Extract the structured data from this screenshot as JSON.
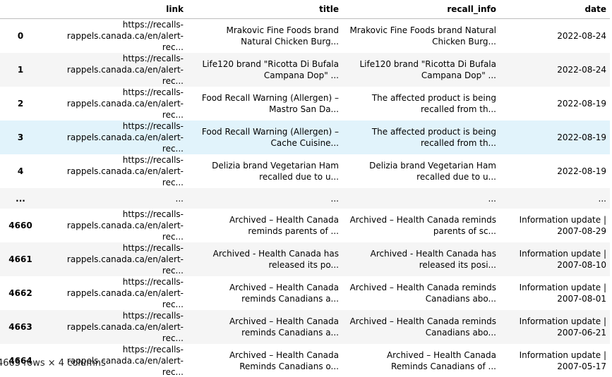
{
  "columns": [
    "link",
    "title",
    "recall_info",
    "date"
  ],
  "rows": [
    {
      "index": "0",
      "link": "https://recalls-rappels.canada.ca/en/alert-rec...",
      "title": "Mrakovic Fine Foods brand Natural Chicken Burg...",
      "recall_info": "Mrakovic Fine Foods brand Natural Chicken Burg...",
      "date": "2022-08-24"
    },
    {
      "index": "1",
      "link": "https://recalls-rappels.canada.ca/en/alert-rec...",
      "title": "Life120 brand \"Ricotta Di Bufala Campana Dop\" ...",
      "recall_info": "Life120 brand \"Ricotta Di Bufala Campana Dop\" ...",
      "date": "2022-08-24"
    },
    {
      "index": "2",
      "link": "https://recalls-rappels.canada.ca/en/alert-rec...",
      "title": "Food Recall Warning (Allergen) – Mastro San Da...",
      "recall_info": "The affected product is being recalled from th...",
      "date": "2022-08-19"
    },
    {
      "index": "3",
      "link": "https://recalls-rappels.canada.ca/en/alert-rec...",
      "title": "Food Recall Warning (Allergen) – Cache Cuisine...",
      "recall_info": "The affected product is being recalled from th...",
      "date": "2022-08-19"
    },
    {
      "index": "4",
      "link": "https://recalls-rappels.canada.ca/en/alert-rec...",
      "title": "Delizia brand Vegetarian Ham recalled due to u...",
      "recall_info": "Delizia brand Vegetarian Ham recalled due to u...",
      "date": "2022-08-19"
    },
    {
      "index": "...",
      "link": "...",
      "title": "...",
      "recall_info": "...",
      "date": "..."
    },
    {
      "index": "4660",
      "link": "https://recalls-rappels.canada.ca/en/alert-rec...",
      "title": "Archived – Health Canada reminds parents of ...",
      "recall_info": "Archived – Health Canada reminds parents of sc...",
      "date": "Information update | 2007-08-29"
    },
    {
      "index": "4661",
      "link": "https://recalls-rappels.canada.ca/en/alert-rec...",
      "title": "Archived - Health Canada has released its po...",
      "recall_info": "Archived - Health Canada has released its posi...",
      "date": "Information update | 2007-08-10"
    },
    {
      "index": "4662",
      "link": "https://recalls-rappels.canada.ca/en/alert-rec...",
      "title": "Archived – Health Canada reminds Canadians a...",
      "recall_info": "Archived – Health Canada reminds Canadians abo...",
      "date": "Information update | 2007-08-01"
    },
    {
      "index": "4663",
      "link": "https://recalls-rappels.canada.ca/en/alert-rec...",
      "title": "Archived – Health Canada reminds Canadians a...",
      "recall_info": "Archived – Health Canada reminds Canadians abo...",
      "date": "Information update | 2007-06-21"
    },
    {
      "index": "4664",
      "link": "https://recalls-rappels.canada.ca/en/alert-rec...",
      "title": "Archived – Health Canada Reminds Canadians o...",
      "recall_info": "Archived – Health Canada Reminds Canadians of ...",
      "date": "Information update | 2007-05-17"
    }
  ],
  "footer": "4665 rows × 4 columns",
  "colors": {
    "stripe": "#f5f5f5",
    "hover": "#e1f3fb",
    "header_border": "#bdbdbd"
  }
}
